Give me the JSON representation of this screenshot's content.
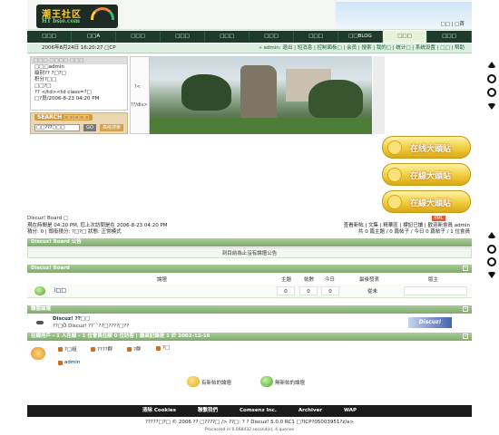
{
  "header": {
    "logo_title": "潮王社区",
    "logo_sub": "HT bsie.com",
    "top_links": "□□ | □首"
  },
  "nav": [
    "□□□",
    "□□A",
    "□□□",
    "□□□",
    "□□□",
    "□□□",
    "□□□",
    "□□BLOG",
    "□□□",
    "□□□"
  ],
  "nav_active_index": 8,
  "userbar": {
    "datetime": "2006年8月24日 16:20:27 □CP",
    "user_links": "» admin: 退出 | 短消息 | 控制面板□ | 会员 | 搜索 | 我的□ | 统计□ | 系统设置 | □□ | 帮助"
  },
  "login_box": {
    "head": "□□□ □□□□ □□□",
    "lines": [
      "□□□admin",
      "级别??  ?□?□",
      "积分?□□",
      "□□?□",
      "?? </td><td class=?□",
      "□?员/2006-8-23 04:20 PM"
    ]
  },
  "search": {
    "label": "SEARCH □□□□□",
    "input_value": "□□???□□□",
    "go_label": "GO",
    "advanced_label": "高级搜索"
  },
  "photo": {
    "side_text_1": "?<",
    "side_text_2": "??/div>"
  },
  "promo_buttons": [
    "在线大頭貼",
    "在線大頭貼",
    "在線大頭貼"
  ],
  "breadcrumb": "Discuz! Board □",
  "rss_label": "XML",
  "info": {
    "left_line1": "現在時間是 04:20 PM, 您上次訪問是在 2006-8-23 04:20 PM",
    "left_line2": "積分: 0 | 頭銜積分: ?□?□ 狀態: 正常模式",
    "right_line1": "查看新帖 | 文集 | 精華區 | 標記已讀 | 歡迎新會員 admin",
    "right_line2": "共 0 篇主題 / 0 篇帖子 / 今日 0 篇帖子 / 1 位會員"
  },
  "sections": {
    "board_head": "Discuz! Board 公告",
    "announce_text": "到目前為止沒有論壇公告",
    "forum_head": "Discuz! Board",
    "links_head": "聯盟論壇",
    "online_head": "在線用戶 - 1 人在線 - 1 位會員在線 0 位訪客 | 最高記錄是 1 於 2002-12-16",
    "toggle": "-"
  },
  "forum_columns": {
    "forum": "論壇",
    "topics": "主題",
    "posts": "帖數",
    "today": "今日",
    "last_post": "最後發表",
    "moderator": "版主"
  },
  "forum_row": {
    "name": "i□□",
    "topics": "0",
    "posts": "0",
    "today": "0",
    "last_post": "從未"
  },
  "links": {
    "title": "Discuz! ??□□",
    "desc": "??□Ö Discuz! ??``??□????□??",
    "logo": "Discuz!"
  },
  "online_legend": [
    "?□組",
    "????群",
    "?群",
    "?□"
  ],
  "online_user": "admin",
  "status_legend": {
    "new": "有新帖的論壇",
    "no_new": "無新帖的論壇"
  },
  "footer": {
    "links": [
      "清除 Cookies",
      "聯繫我們",
      "Comsenz Inc.",
      "Archiver",
      "WAP"
    ],
    "copyright": "?????□?□ © 2006  ??  □????□ /> ??□:  ?  ?  Discuz! 5.0.0 RC1  □?ICP?05003951?z/a>",
    "processed": "Processed in 0.068432 second(s), 4 queries"
  },
  "colors": {
    "nav_bg": "#1e3a2a",
    "section_green": "#8cb67a",
    "promo_gold": "#f1cc3b"
  }
}
